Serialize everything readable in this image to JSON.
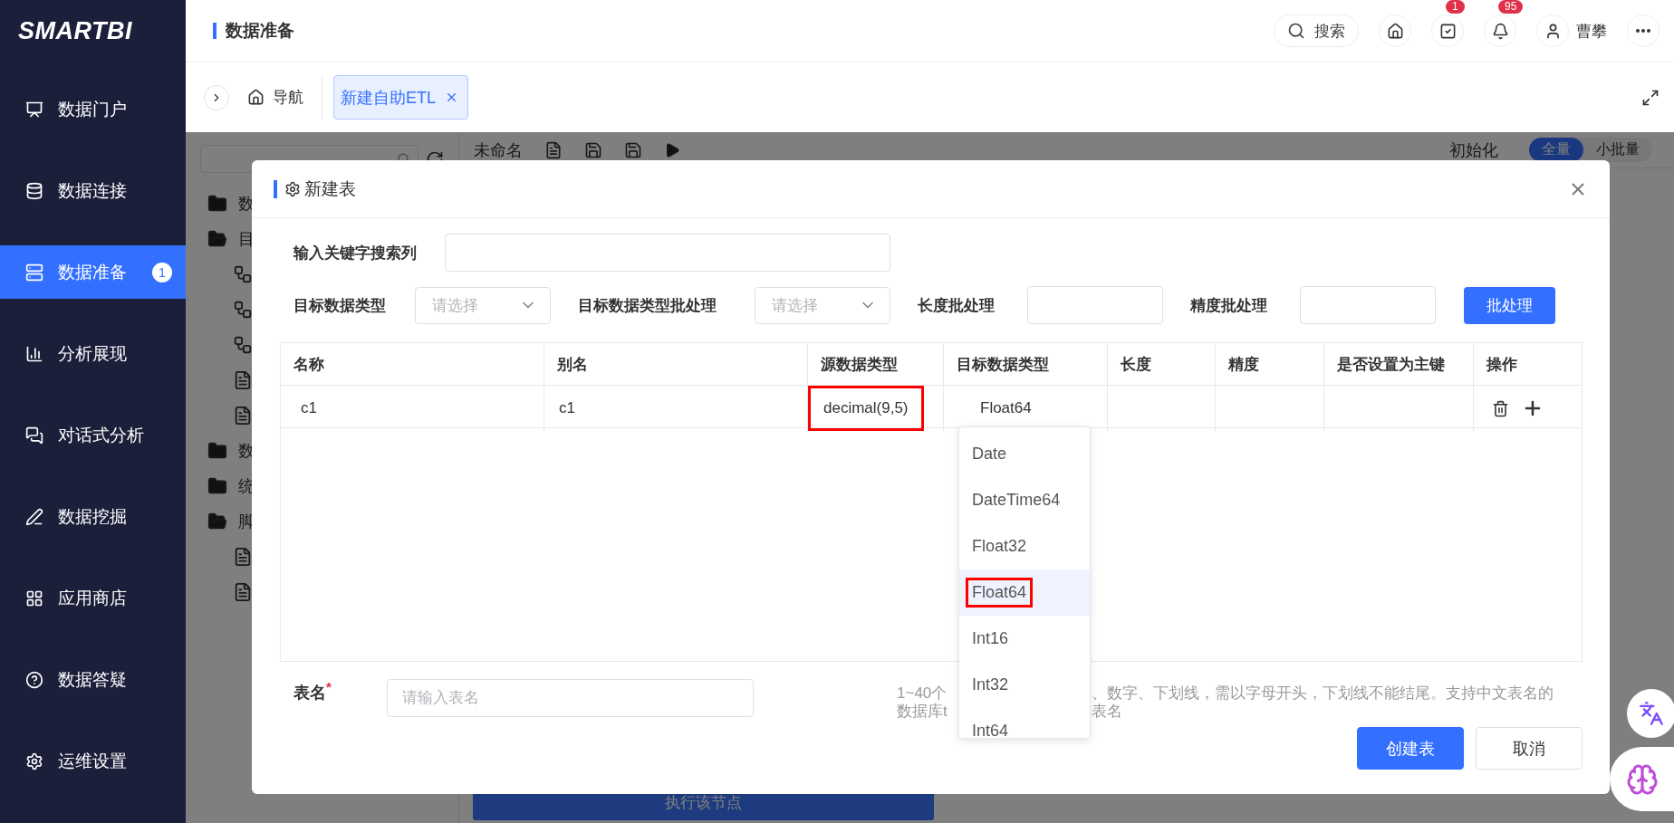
{
  "sidebar": {
    "logo": "SMARTBI",
    "items": [
      {
        "kind": "portal",
        "label": "数据门户",
        "selected": false
      },
      {
        "kind": "connect",
        "label": "数据连接",
        "selected": false
      },
      {
        "kind": "prepare",
        "label": "数据准备",
        "selected": true,
        "badge": "1"
      },
      {
        "kind": "analysis",
        "label": "分析展现",
        "selected": false
      },
      {
        "kind": "chat",
        "label": "对话式分析",
        "selected": false
      },
      {
        "kind": "mining",
        "label": "数据挖掘",
        "selected": false
      },
      {
        "kind": "store",
        "label": "应用商店",
        "selected": false
      },
      {
        "kind": "help",
        "label": "数据答疑",
        "selected": false
      },
      {
        "kind": "settings",
        "label": "运维设置",
        "selected": false
      }
    ]
  },
  "header": {
    "title": "数据准备",
    "search": "搜索",
    "task_badge": "1",
    "notice_badge": "95",
    "user": "曹攀"
  },
  "tabs": {
    "nav": "导航",
    "items": [
      {
        "label": "新建自助ETL",
        "selected": true
      }
    ]
  },
  "background": {
    "tree": [
      {
        "kind": "folder",
        "label": "数"
      },
      {
        "kind": "folder-open",
        "label": "目"
      },
      {
        "kind": "node"
      },
      {
        "kind": "node"
      },
      {
        "kind": "node"
      },
      {
        "kind": "file"
      },
      {
        "kind": "file"
      },
      {
        "kind": "folder",
        "label": "数"
      },
      {
        "kind": "folder",
        "label": "统"
      },
      {
        "kind": "folder-open",
        "label": "脚"
      },
      {
        "kind": "file"
      },
      {
        "kind": "file"
      }
    ],
    "toolbar": {
      "title": "未命名",
      "init": "初始化",
      "modes": [
        {
          "label": "全量",
          "selected": true
        },
        {
          "label": "小批量",
          "selected": false
        }
      ]
    },
    "run_button": "执行该节点"
  },
  "dialog": {
    "title": "新建表",
    "search_label": "输入关键字搜索列",
    "batch": [
      {
        "kind": "select",
        "label": "目标数据类型",
        "placeholder": "请选择"
      },
      {
        "kind": "select",
        "label": "目标数据类型批处理",
        "placeholder": "请选择"
      },
      {
        "kind": "input",
        "label": "长度批处理"
      },
      {
        "kind": "input",
        "label": "精度批处理"
      }
    ],
    "batch_button": "批处理",
    "table": {
      "columns": [
        "名称",
        "别名",
        "源数据类型",
        "目标数据类型",
        "长度",
        "精度",
        "是否设置为主键",
        "操作"
      ],
      "rows": [
        {
          "name": "c1",
          "alias": "c1",
          "source_type": "decimal(9,5)",
          "source_annotated": true,
          "target_type": "Float64"
        }
      ]
    },
    "dropdown": {
      "options": [
        {
          "label": "Date",
          "selected": false,
          "annotated": false
        },
        {
          "label": "DateTime64",
          "selected": false,
          "annotated": false
        },
        {
          "label": "Float32",
          "selected": false,
          "annotated": false
        },
        {
          "label": "Float64",
          "selected": true,
          "annotated": true
        },
        {
          "label": "Int16",
          "selected": false,
          "annotated": false
        },
        {
          "label": "Int32",
          "selected": false,
          "annotated": false
        },
        {
          "label": "Int64",
          "selected": false,
          "annotated": false
        }
      ]
    },
    "table_name": {
      "label": "表名",
      "required_mark": "*",
      "placeholder": "请输入表名"
    },
    "hint_lines": [
      {
        "before": "1~40个",
        "after": "、数字、下划线，需以字母开头，下划线不能结尾。支持中文表名的"
      },
      {
        "before": "数据库t",
        "after": "表名"
      }
    ],
    "buttons": [
      {
        "kind": "primary",
        "label": "创建表"
      },
      {
        "kind": "default",
        "label": "取消"
      }
    ]
  }
}
